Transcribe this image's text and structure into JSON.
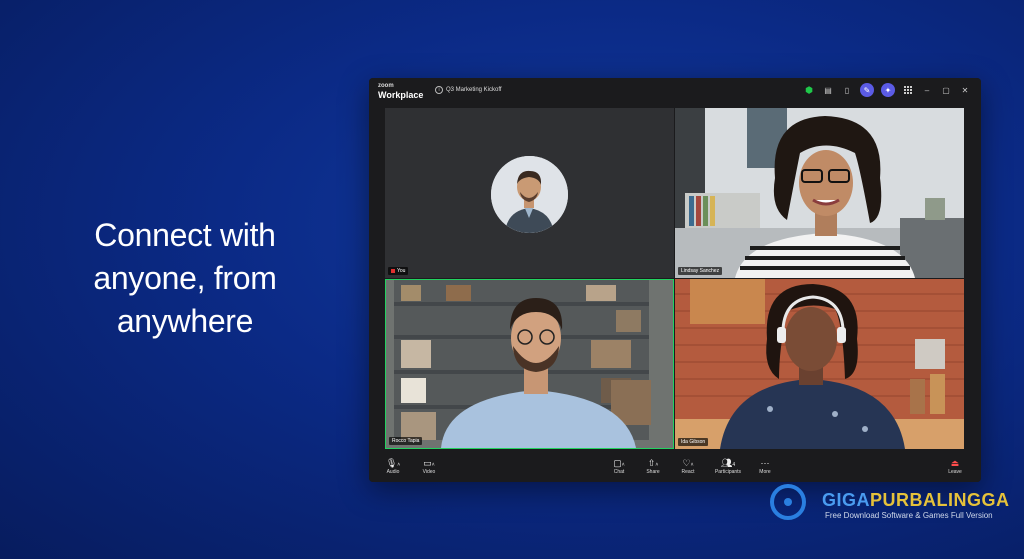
{
  "tagline": {
    "line1": "Connect with",
    "line2": "anyone, from",
    "line3": "anywhere"
  },
  "app": {
    "logo_top": "zoom",
    "logo_bottom": "Workplace",
    "meeting_title": "Q3 Marketing Kickoff"
  },
  "participants": [
    {
      "name": "You"
    },
    {
      "name": "Lindsay Sanchez"
    },
    {
      "name": "Rocco Tapia"
    },
    {
      "name": "Ida Gibson"
    }
  ],
  "toolbar": {
    "audio": "Audio",
    "video": "Video",
    "chat": "Chat",
    "share": "Share",
    "react": "React",
    "participants": "Participants",
    "participants_count": "4",
    "more": "More",
    "leave": "Leave"
  },
  "watermark": {
    "title_part1": "GIGA",
    "title_part2": "PURBALINGGA",
    "subtitle": "Free Download Software & Games Full Version"
  },
  "colors": {
    "accent": "#5b5be5",
    "active_speaker": "#23d160",
    "leave": "#ff4d4d",
    "security": "#1fc84a"
  }
}
